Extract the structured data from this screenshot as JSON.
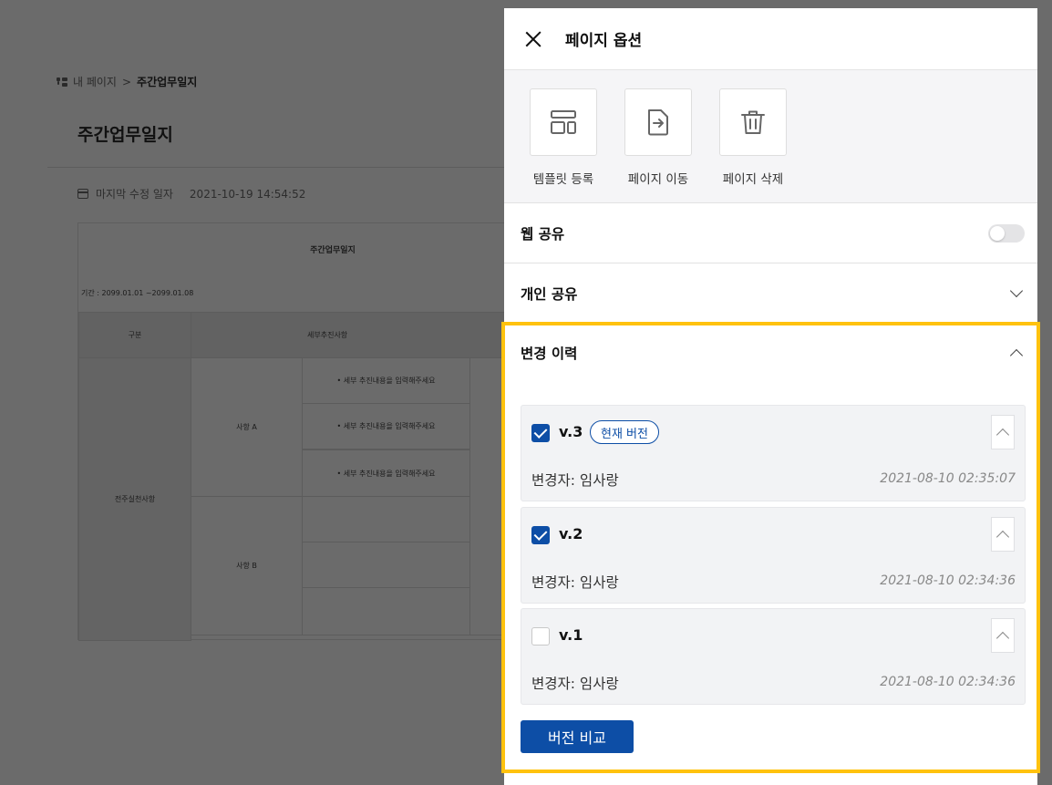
{
  "background": {
    "breadcrumb": {
      "root": "내 페이지",
      "separator": ">",
      "current": "주간업무일지"
    },
    "page_title": "주간업무일지",
    "modified_label": "마지막 수정 일자",
    "modified_date": "2021-10-19 14:54:52",
    "doc": {
      "heading": "주간업무일지",
      "period": "기간 : 2099.01.01 ~2099.01.08",
      "col_category": "구분",
      "col_detail": "세부추진사항",
      "group_label": "전주실천사항",
      "item_a": "사항 A",
      "item_b": "사항 B",
      "detail_placeholder": "• 세부 추진내용을 입력해주세요"
    }
  },
  "panel": {
    "title": "페이지 옵션",
    "actions": [
      {
        "label": "템플릿 등록",
        "icon": "template-icon"
      },
      {
        "label": "페이지 이동",
        "icon": "move-page-icon"
      },
      {
        "label": "페이지 삭제",
        "icon": "trash-icon"
      }
    ],
    "web_share": {
      "label": "웹 공유",
      "enabled": false
    },
    "private_share": {
      "label": "개인 공유"
    },
    "history": {
      "label": "변경 이력",
      "versions": [
        {
          "name": "v.3",
          "badge": "현재 버전",
          "checked": true,
          "editor": "변경자: 임사랑",
          "date": "2021-08-10 02:35:07"
        },
        {
          "name": "v.2",
          "badge": "",
          "checked": true,
          "editor": "변경자: 임사랑",
          "date": "2021-08-10 02:34:36"
        },
        {
          "name": "v.1",
          "badge": "",
          "checked": false,
          "editor": "변경자: 임사랑",
          "date": "2021-08-10 02:34:36"
        }
      ],
      "compare_button": "버전 비교"
    }
  },
  "colors": {
    "accent": "#0d4ea6",
    "highlight": "#ffc20e",
    "overlay": "#6b6b6b"
  }
}
